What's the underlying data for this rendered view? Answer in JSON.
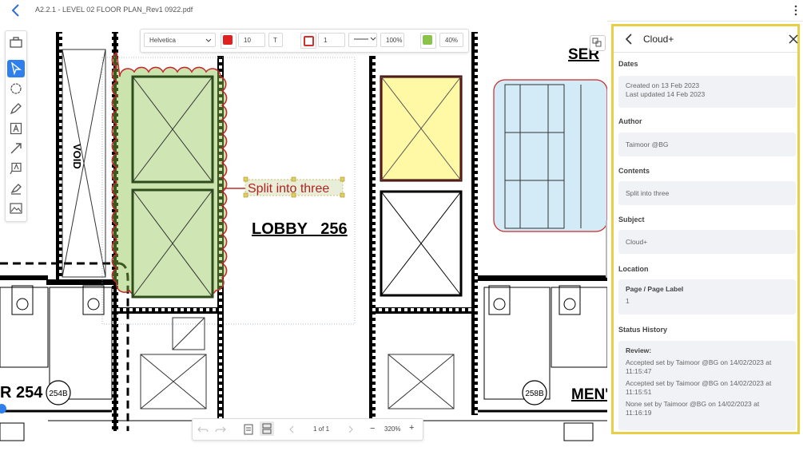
{
  "header": {
    "filename": "A2.2.1 - LEVEL 02 FLOOR PLAN_Rev1 0922.pdf"
  },
  "toolbar": {
    "font": "Helvetica",
    "font_size": "10",
    "text_tool": "T",
    "stroke_width": "1",
    "stroke_opacity": "100%",
    "fill_opacity": "40%",
    "font_color": "#e02020",
    "stroke_color": "#d32f2f",
    "fill_color": "#8bc34a"
  },
  "tools": [
    "briefcase-icon",
    "pointer-icon",
    "cloud-icon",
    "pen-icon",
    "text-box-icon",
    "arrow-icon",
    "callout-icon",
    "highlighter-icon",
    "image-icon"
  ],
  "drawing": {
    "annotation_text": "Split into three",
    "room_label": "LOBBY   256",
    "void_label": "VOID",
    "tag_254b": "254B",
    "tag_258b": "258B",
    "room_left": "R 254",
    "room_right": "MEN'",
    "room_top_right": "SER"
  },
  "pager": {
    "page": "1 of 1",
    "zoom": "320%",
    "minus": "−",
    "plus": "+"
  },
  "panel": {
    "title": "Cloud+",
    "dates_label": "Dates",
    "created": "Created on 13 Feb 2023",
    "updated": "Last updated 14 Feb 2023",
    "author_label": "Author",
    "author": "Taimoor @BG",
    "contents_label": "Contents",
    "contents": "Split into three",
    "subject_label": "Subject",
    "subject": "Cloud+",
    "location_label": "Location",
    "page_label_title": "Page / Page Label",
    "page_label_value": "1",
    "status_label": "Status History",
    "review_title": "Review:",
    "history": [
      {
        "text": "Accepted set by Taimoor @BG on 14/02/2023 at",
        "time": "11:15:47"
      },
      {
        "text": "Accepted set by Taimoor @BG on 14/02/2023 at",
        "time": "11:15:51"
      },
      {
        "text": "None set by Taimoor @BG on 14/02/2023 at",
        "time": "11:16:19"
      }
    ]
  }
}
